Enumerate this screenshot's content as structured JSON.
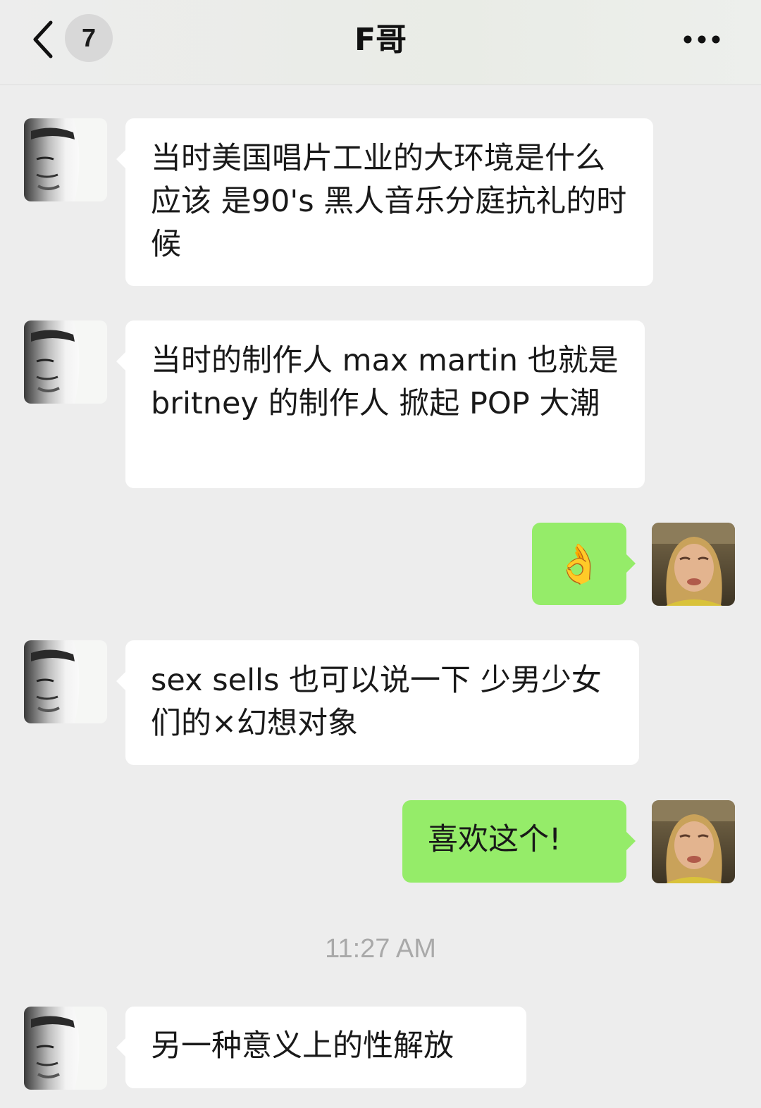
{
  "header": {
    "unread_count": "7",
    "title": "F哥"
  },
  "messages": [
    {
      "side": "left",
      "text": "当时美国唱片工业的大环境是什么 应该 是90's 黑人音乐分庭抗礼的时候"
    },
    {
      "side": "left",
      "text": "当时的制作人 max martin 也就是 britney 的制作人 掀起 POP 大潮"
    },
    {
      "side": "right",
      "text": "👌"
    },
    {
      "side": "left",
      "text": "sex sells 也可以说一下 少男少女们的×幻想对象"
    },
    {
      "side": "right",
      "text": "喜欢这个!"
    },
    {
      "side": "left",
      "text": "另一种意义上的性解放"
    }
  ],
  "timestamp": "11:27 AM",
  "colors": {
    "background": "#ededed",
    "sent_bubble": "#95ec69",
    "received_bubble": "#ffffff"
  }
}
